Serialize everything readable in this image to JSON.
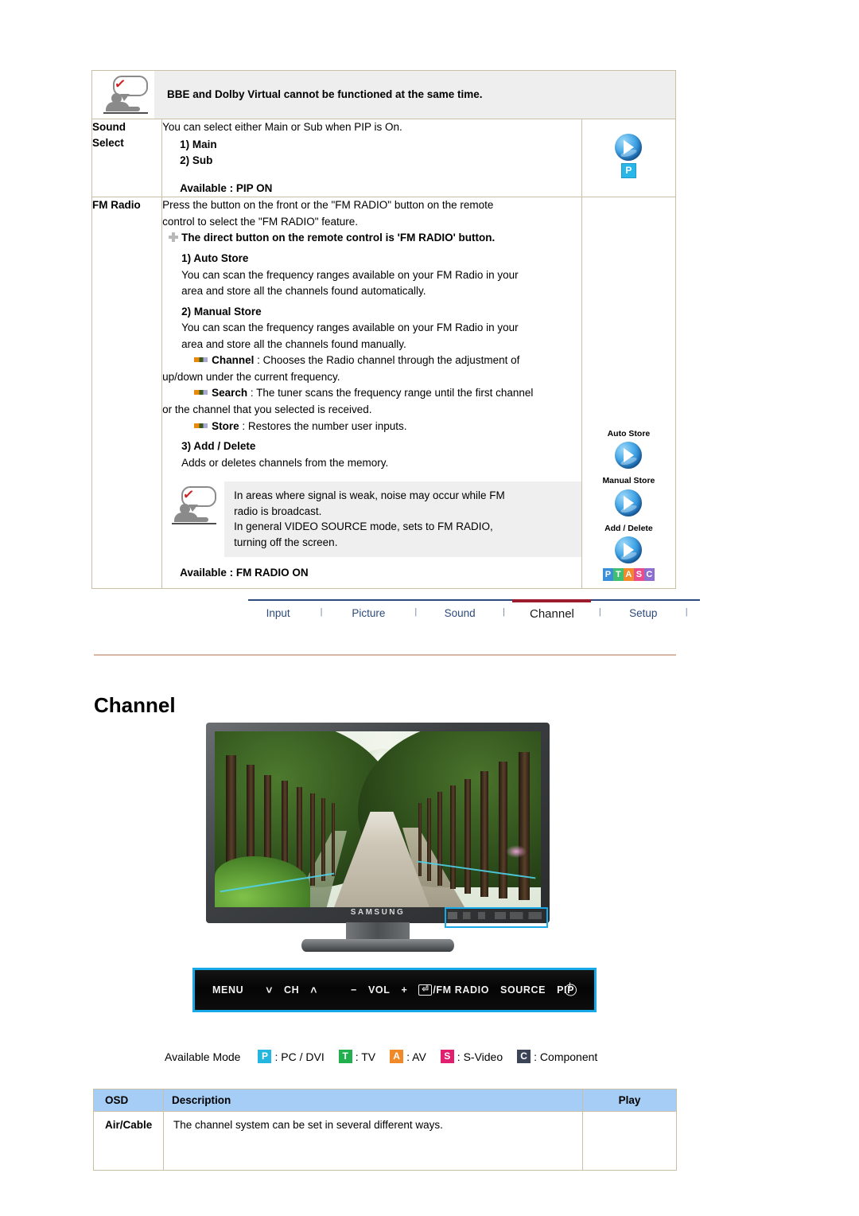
{
  "note_top": {
    "text": "BBE and Dolby Virtual cannot be functioned at the same time.",
    "icon": "person-speech-check-icon"
  },
  "spec_table": {
    "rows": [
      {
        "label": "Sound\nSelect",
        "label_line1": "Sound",
        "label_line2": "Select",
        "intro": "You can select either Main or Sub when PIP is On.",
        "items": [
          "1) Main",
          "2) Sub"
        ],
        "available": "Available : PIP ON",
        "play_icon": "play-sphere-icon",
        "play_badge": "P"
      },
      {
        "label_line1": "FM Radio",
        "intro_line1": "Press the button on the front or the \"FM RADIO\" button on the remote",
        "intro_line2": "control to select the \"FM RADIO\" feature.",
        "tip": "The direct button on the remote control is 'FM RADIO' button.",
        "sections": [
          {
            "heading": "1) Auto Store",
            "body_line1": "You can scan the frequency ranges available on your FM Radio in your",
            "body_line2": "area and store all the channels found automatically."
          },
          {
            "heading": "2) Manual Store",
            "body_line1": "You can scan the frequency ranges available on your FM Radio in your",
            "body_line2": "area and store all the channels found manually."
          }
        ],
        "bullets": [
          {
            "term": "Channel",
            "desc_line1": " : Chooses the Radio channel through the adjustment of",
            "desc_line2": "up/down under the current frequency."
          },
          {
            "term": "Search",
            "desc_line1": " : The tuner scans the frequency range until the first channel",
            "desc_line2": "or the channel that you selected is received."
          },
          {
            "term": "Store",
            "desc_line1": " : Restores the number user inputs.",
            "desc_line2": ""
          }
        ],
        "add_delete": {
          "heading": "3) Add / Delete",
          "body": "Adds or deletes channels from the memory."
        },
        "inner_note": {
          "line1": "In areas where signal is weak, noise may occur while FM",
          "line2": "radio is broadcast.",
          "line3": "In general VIDEO SOURCE mode, sets to FM RADIO,",
          "line4": "turning off the screen.",
          "icon": "person-speech-check-icon"
        },
        "available": "Available : FM RADIO ON",
        "play_icons": [
          {
            "caption": "Auto Store",
            "icon": "play-sphere-icon"
          },
          {
            "caption": "Manual Store",
            "icon": "play-sphere-icon"
          },
          {
            "caption": "Add / Delete",
            "icon": "play-sphere-icon"
          }
        ],
        "ptasc": [
          "P",
          "T",
          "A",
          "S",
          "C"
        ]
      }
    ]
  },
  "tabs": {
    "items": [
      {
        "label": "Input",
        "active": false
      },
      {
        "label": "Picture",
        "active": false
      },
      {
        "label": "Sound",
        "active": false
      },
      {
        "label": "Channel",
        "active": true
      },
      {
        "label": "Setup",
        "active": false
      }
    ],
    "separator": "|",
    "active_underline_color": "#9c1c2e",
    "link_color": "#2c4a7c"
  },
  "page_heading": "Channel",
  "monitor": {
    "brand": "SAMSUNG",
    "highlight_color": "#18a8e8",
    "controls": {
      "menu": "MENU",
      "chev_down": "˅",
      "ch": "CH",
      "chev_up": "˄",
      "minus": "−",
      "vol": "VOL",
      "plus": "+",
      "enter_key": "⏎",
      "fm_radio": "/FM RADIO",
      "source": "SOURCE",
      "pip": "PIP",
      "power": "power-icon"
    }
  },
  "available_mode": {
    "label": "Available Mode",
    "modes": [
      {
        "badge": "P",
        "text": ": PC / DVI",
        "color": "#25b6e0"
      },
      {
        "badge": "T",
        "text": ": TV",
        "color": "#22b04e"
      },
      {
        "badge": "A",
        "text": ": AV",
        "color": "#f08a28"
      },
      {
        "badge": "S",
        "text": ": S-Video",
        "color": "#e0206e"
      },
      {
        "badge": "C",
        "text": ": Component",
        "color": "#3c4558"
      }
    ]
  },
  "osd_table": {
    "header_bg": "#a5cdf5",
    "headers": [
      "OSD",
      "Description",
      "Play"
    ],
    "rows": [
      {
        "osd": "Air/Cable",
        "description": "The channel system can be set in several different ways.",
        "play": ""
      }
    ]
  }
}
